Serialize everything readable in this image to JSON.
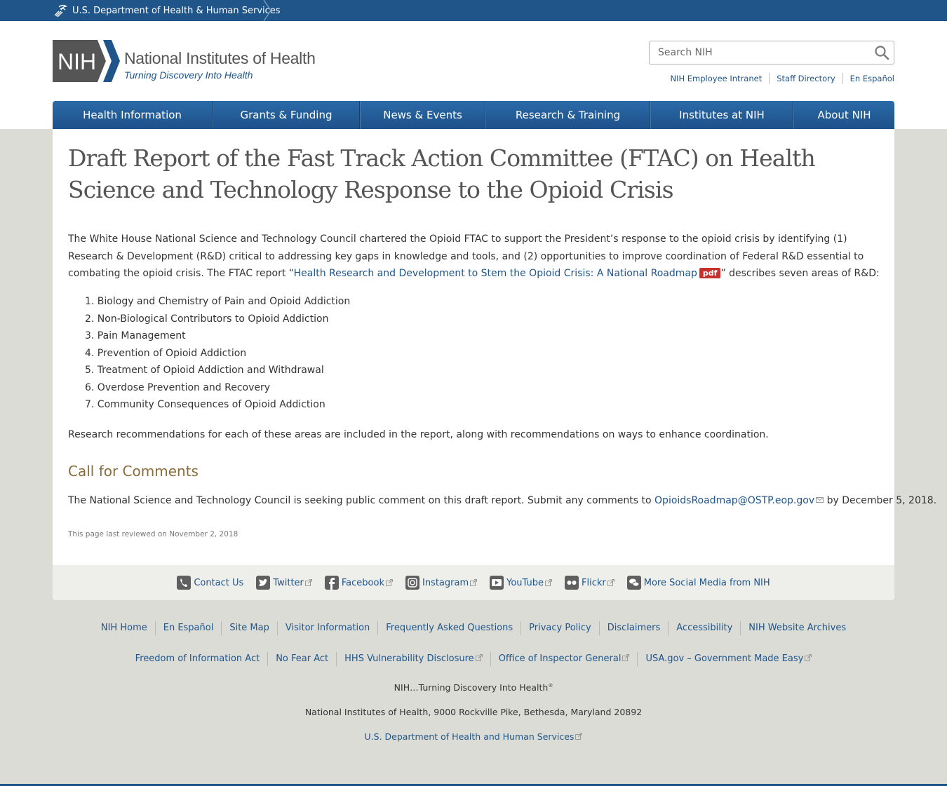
{
  "hhs_bar": {
    "label": "U.S. Department of Health & Human Services"
  },
  "logo": {
    "mark": "NIH",
    "title": "National Institutes of Health",
    "tagline": "Turning Discovery Into Health"
  },
  "search": {
    "placeholder": "Search NIH"
  },
  "utility_links": [
    "NIH Employee Intranet",
    "Staff Directory",
    "En Español"
  ],
  "nav": [
    "Health Information",
    "Grants & Funding",
    "News & Events",
    "Research & Training",
    "Institutes at NIH",
    "About NIH"
  ],
  "content": {
    "title": "Draft Report of the Fast Track Action Committee (FTAC) on Health Science and Technology Response to the Opioid Crisis",
    "intro_before": "The White House National Science and Technology Council chartered the Opioid FTAC to support the President’s response to the opioid crisis by identifying (1) Research & Development (R&D) critical to addressing key gaps in knowledge and tools, and (2) opportunities to improve coordination of Federal R&D essential to combating the opioid crisis. The FTAC report “",
    "intro_link": "Health Research and Development to Stem the Opioid Crisis: A National Roadmap",
    "pdf_badge": "pdf",
    "intro_after": "” describes seven areas of R&D:",
    "areas": [
      "1. Biology and Chemistry of Pain and Opioid Addiction",
      "2. Non-Biological Contributors to Opioid Addiction",
      "3. Pain Management",
      "4. Prevention of Opioid Addiction",
      "5. Treatment of Opioid Addiction and Withdrawal",
      "6. Overdose Prevention and Recovery",
      "7. Community Consequences of Opioid Addiction"
    ],
    "recommendations": "Research recommendations for each of these areas are included in the report, along with recommendations on ways to enhance coordination.",
    "cfc_heading": "Call for Comments",
    "cfc_before": "The National Science and Technology Council is seeking public comment on this draft report. Submit any comments to ",
    "cfc_email": "OpioidsRoadmap@OSTP.eop.gov",
    "cfc_after": " by December 5, 2018.",
    "reviewed": "This page last reviewed on November 2, 2018"
  },
  "social": [
    {
      "label": "Contact Us",
      "icon": "phone-icon",
      "external": false
    },
    {
      "label": "Twitter",
      "icon": "twitter-icon",
      "external": true
    },
    {
      "label": "Facebook",
      "icon": "facebook-icon",
      "external": true
    },
    {
      "label": "Instagram",
      "icon": "instagram-icon",
      "external": true
    },
    {
      "label": "YouTube",
      "icon": "youtube-icon",
      "external": true
    },
    {
      "label": "Flickr",
      "icon": "flickr-icon",
      "external": true
    },
    {
      "label": "More Social Media from NIH",
      "icon": "chat-icon",
      "external": false
    }
  ],
  "footer_links_1": [
    "NIH Home",
    "En Español",
    "Site Map",
    "Visitor Information",
    "Frequently Asked Questions",
    "Privacy Policy",
    "Disclaimers",
    "Accessibility",
    "NIH Website Archives"
  ],
  "footer_links_2": [
    {
      "label": "Freedom of Information Act",
      "external": false
    },
    {
      "label": "No Fear Act",
      "external": false
    },
    {
      "label": "HHS Vulnerability Disclosure",
      "external": true
    },
    {
      "label": "Office of Inspector General",
      "external": true
    },
    {
      "label": "USA.gov – Government Made Easy",
      "external": true
    }
  ],
  "footer_tagline": "NIH…Turning Discovery Into Health",
  "footer_tagline_mark": "®",
  "footer_address": "National Institutes of Health, 9000 Rockville Pike, Bethesda, Maryland 20892",
  "footer_hhs": "U.S. Department of Health and Human Services",
  "colors": {
    "brand_blue": "#20558a",
    "heading_gold": "#8a6d3b",
    "pdf_red": "#c9302c",
    "page_bg": "#dcdcd7"
  }
}
